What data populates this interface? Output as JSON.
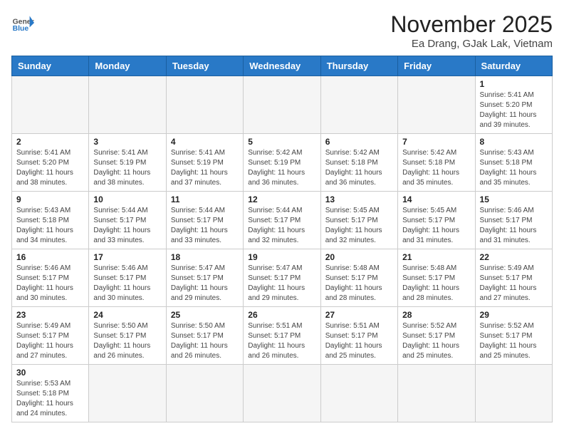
{
  "header": {
    "logo_general": "General",
    "logo_blue": "Blue",
    "month_title": "November 2025",
    "subtitle": "Ea Drang, GJak Lak, Vietnam"
  },
  "weekdays": [
    "Sunday",
    "Monday",
    "Tuesday",
    "Wednesday",
    "Thursday",
    "Friday",
    "Saturday"
  ],
  "weeks": [
    [
      {
        "day": "",
        "info": ""
      },
      {
        "day": "",
        "info": ""
      },
      {
        "day": "",
        "info": ""
      },
      {
        "day": "",
        "info": ""
      },
      {
        "day": "",
        "info": ""
      },
      {
        "day": "",
        "info": ""
      },
      {
        "day": "1",
        "info": "Sunrise: 5:41 AM\nSunset: 5:20 PM\nDaylight: 11 hours\nand 39 minutes."
      }
    ],
    [
      {
        "day": "2",
        "info": "Sunrise: 5:41 AM\nSunset: 5:20 PM\nDaylight: 11 hours\nand 38 minutes."
      },
      {
        "day": "3",
        "info": "Sunrise: 5:41 AM\nSunset: 5:19 PM\nDaylight: 11 hours\nand 38 minutes."
      },
      {
        "day": "4",
        "info": "Sunrise: 5:41 AM\nSunset: 5:19 PM\nDaylight: 11 hours\nand 37 minutes."
      },
      {
        "day": "5",
        "info": "Sunrise: 5:42 AM\nSunset: 5:19 PM\nDaylight: 11 hours\nand 36 minutes."
      },
      {
        "day": "6",
        "info": "Sunrise: 5:42 AM\nSunset: 5:18 PM\nDaylight: 11 hours\nand 36 minutes."
      },
      {
        "day": "7",
        "info": "Sunrise: 5:42 AM\nSunset: 5:18 PM\nDaylight: 11 hours\nand 35 minutes."
      },
      {
        "day": "8",
        "info": "Sunrise: 5:43 AM\nSunset: 5:18 PM\nDaylight: 11 hours\nand 35 minutes."
      }
    ],
    [
      {
        "day": "9",
        "info": "Sunrise: 5:43 AM\nSunset: 5:18 PM\nDaylight: 11 hours\nand 34 minutes."
      },
      {
        "day": "10",
        "info": "Sunrise: 5:44 AM\nSunset: 5:17 PM\nDaylight: 11 hours\nand 33 minutes."
      },
      {
        "day": "11",
        "info": "Sunrise: 5:44 AM\nSunset: 5:17 PM\nDaylight: 11 hours\nand 33 minutes."
      },
      {
        "day": "12",
        "info": "Sunrise: 5:44 AM\nSunset: 5:17 PM\nDaylight: 11 hours\nand 32 minutes."
      },
      {
        "day": "13",
        "info": "Sunrise: 5:45 AM\nSunset: 5:17 PM\nDaylight: 11 hours\nand 32 minutes."
      },
      {
        "day": "14",
        "info": "Sunrise: 5:45 AM\nSunset: 5:17 PM\nDaylight: 11 hours\nand 31 minutes."
      },
      {
        "day": "15",
        "info": "Sunrise: 5:46 AM\nSunset: 5:17 PM\nDaylight: 11 hours\nand 31 minutes."
      }
    ],
    [
      {
        "day": "16",
        "info": "Sunrise: 5:46 AM\nSunset: 5:17 PM\nDaylight: 11 hours\nand 30 minutes."
      },
      {
        "day": "17",
        "info": "Sunrise: 5:46 AM\nSunset: 5:17 PM\nDaylight: 11 hours\nand 30 minutes."
      },
      {
        "day": "18",
        "info": "Sunrise: 5:47 AM\nSunset: 5:17 PM\nDaylight: 11 hours\nand 29 minutes."
      },
      {
        "day": "19",
        "info": "Sunrise: 5:47 AM\nSunset: 5:17 PM\nDaylight: 11 hours\nand 29 minutes."
      },
      {
        "day": "20",
        "info": "Sunrise: 5:48 AM\nSunset: 5:17 PM\nDaylight: 11 hours\nand 28 minutes."
      },
      {
        "day": "21",
        "info": "Sunrise: 5:48 AM\nSunset: 5:17 PM\nDaylight: 11 hours\nand 28 minutes."
      },
      {
        "day": "22",
        "info": "Sunrise: 5:49 AM\nSunset: 5:17 PM\nDaylight: 11 hours\nand 27 minutes."
      }
    ],
    [
      {
        "day": "23",
        "info": "Sunrise: 5:49 AM\nSunset: 5:17 PM\nDaylight: 11 hours\nand 27 minutes."
      },
      {
        "day": "24",
        "info": "Sunrise: 5:50 AM\nSunset: 5:17 PM\nDaylight: 11 hours\nand 26 minutes."
      },
      {
        "day": "25",
        "info": "Sunrise: 5:50 AM\nSunset: 5:17 PM\nDaylight: 11 hours\nand 26 minutes."
      },
      {
        "day": "26",
        "info": "Sunrise: 5:51 AM\nSunset: 5:17 PM\nDaylight: 11 hours\nand 26 minutes."
      },
      {
        "day": "27",
        "info": "Sunrise: 5:51 AM\nSunset: 5:17 PM\nDaylight: 11 hours\nand 25 minutes."
      },
      {
        "day": "28",
        "info": "Sunrise: 5:52 AM\nSunset: 5:17 PM\nDaylight: 11 hours\nand 25 minutes."
      },
      {
        "day": "29",
        "info": "Sunrise: 5:52 AM\nSunset: 5:17 PM\nDaylight: 11 hours\nand 25 minutes."
      }
    ],
    [
      {
        "day": "30",
        "info": "Sunrise: 5:53 AM\nSunset: 5:18 PM\nDaylight: 11 hours\nand 24 minutes."
      },
      {
        "day": "",
        "info": ""
      },
      {
        "day": "",
        "info": ""
      },
      {
        "day": "",
        "info": ""
      },
      {
        "day": "",
        "info": ""
      },
      {
        "day": "",
        "info": ""
      },
      {
        "day": "",
        "info": ""
      }
    ]
  ]
}
